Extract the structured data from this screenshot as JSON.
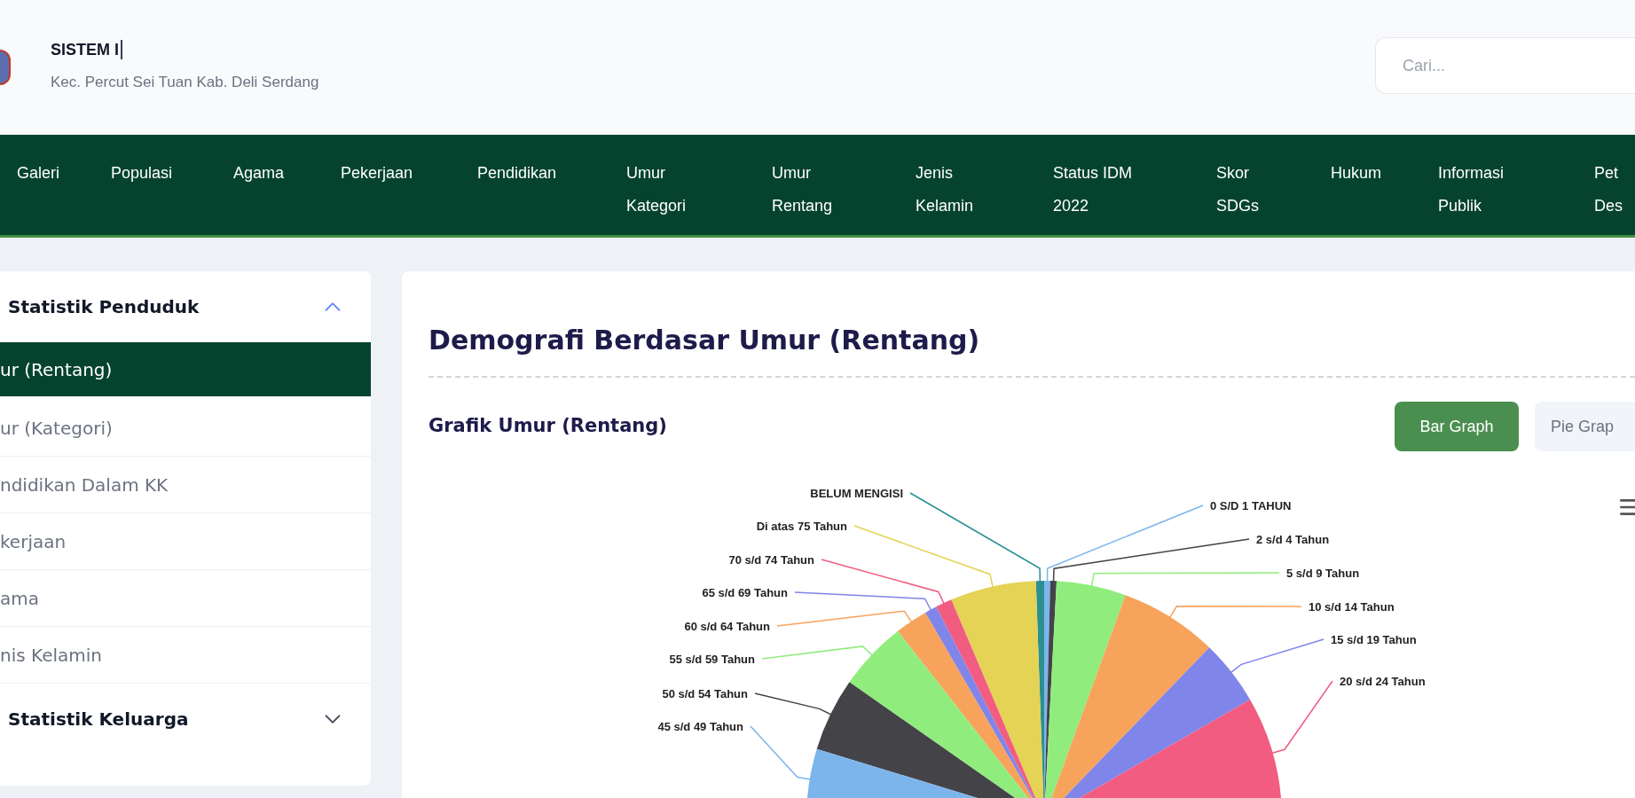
{
  "header": {
    "title": "SISTEM I",
    "subtitle": "Kec. Percut Sei Tuan Kab. Deli Serdang",
    "search": {
      "placeholder": "Cari..."
    }
  },
  "nav": [
    {
      "label": "Galeri"
    },
    {
      "label": "Populasi"
    },
    {
      "label": "Agama"
    },
    {
      "label": "Pekerjaan"
    },
    {
      "label": "Pendidikan"
    },
    {
      "label": "Umur\nKategori"
    },
    {
      "label": "Umur\nRentang"
    },
    {
      "label": "Jenis\nKelamin"
    },
    {
      "label": "Status IDM\n2022"
    },
    {
      "label": "Skor\nSDGs"
    },
    {
      "label": "Hukum"
    },
    {
      "label": "Informasi\nPublik"
    },
    {
      "label": "Pet\nDes"
    }
  ],
  "sidebar": {
    "sections": [
      {
        "title": "Statistik Penduduk",
        "expanded": true,
        "items": [
          {
            "label": "ur (Rentang)",
            "selected": true
          },
          {
            "label": "ur (Kategori)",
            "selected": false
          },
          {
            "label": "ndidikan Dalam KK",
            "selected": false
          },
          {
            "label": "kerjaan",
            "selected": false
          },
          {
            "label": "ama",
            "selected": false
          },
          {
            "label": "nis Kelamin",
            "selected": false
          }
        ]
      },
      {
        "title": "Statistik Keluarga",
        "expanded": false
      }
    ]
  },
  "main": {
    "title": "Demografi Berdasar Umur (Rentang)",
    "chart_title": "Grafik Umur (Rentang)",
    "view_buttons": [
      {
        "label": "Bar Graph",
        "selected": true
      },
      {
        "label": "Pie Grap",
        "selected": false
      }
    ],
    "pie_labels": [
      {
        "label": "BELUM MENGISI",
        "color": "#2b908f"
      },
      {
        "label": "0 S/D 1 TAHUN",
        "color": "#7cb5ec"
      },
      {
        "label": "Di atas 75 Tahun",
        "color": "#e4d354"
      },
      {
        "label": "2 s/d 4 Tahun",
        "color": "#434348"
      },
      {
        "label": "70 s/d 74 Tahun",
        "color": "#f15c80"
      },
      {
        "label": "5 s/d 9 Tahun",
        "color": "#90ed7d"
      },
      {
        "label": "65 s/d 69 Tahun",
        "color": "#8085e9"
      },
      {
        "label": "10 s/d 14 Tahun",
        "color": "#f7a35c"
      },
      {
        "label": "60 s/d 64 Tahun",
        "color": "#f7a35c"
      },
      {
        "label": "15 s/d 19 Tahun",
        "color": "#8085e9"
      },
      {
        "label": "55 s/d 59 Tahun",
        "color": "#90ed7d"
      },
      {
        "label": "20 s/d 24 Tahun",
        "color": "#f15c80"
      },
      {
        "label": "50 s/d 54 Tahun",
        "color": "#434348"
      },
      {
        "label": "45 s/d 49 Tahun",
        "color": "#7cb5ec"
      }
    ]
  }
}
